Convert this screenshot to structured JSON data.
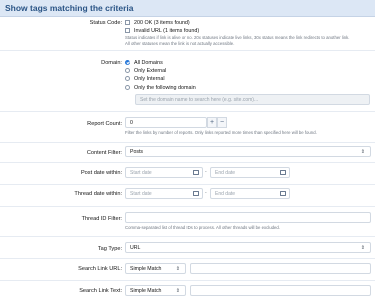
{
  "header": {
    "title": "Show tags matching the criteria"
  },
  "status_code": {
    "label": "Status Code:",
    "options": [
      "200 OK (3 items found)",
      "Invalid URL (1 items found)"
    ],
    "help": [
      "Status indicates if link is alive or no. 20x statuses indicate live links, 30x status means the link redirects to another link.",
      "All other statuses mean the link is not actually accessible."
    ]
  },
  "domain": {
    "label": "Domain:",
    "options": [
      "All Domains",
      "Only External",
      "Only Internal",
      "Only the following domain"
    ],
    "selected": "All Domains",
    "placeholder": "Set the domain name to search here (e.g. site.com)..."
  },
  "report_count": {
    "label": "Report Count:",
    "value": "0",
    "plus": "+",
    "minus": "−",
    "help": "Filter the links by number of reports. Only links reported more times than specified here will be found."
  },
  "content_filter": {
    "label": "Content Filter:",
    "value": "Posts"
  },
  "post_date": {
    "label": "Post date within:",
    "start_placeholder": "Start date",
    "end_placeholder": "End date",
    "separator": "-"
  },
  "thread_date": {
    "label": "Thread date within:",
    "start_placeholder": "Start date",
    "end_placeholder": "End date",
    "separator": "-"
  },
  "thread_id": {
    "label": "Thread ID Filter:",
    "help": "Comma-separated list of thread IDs to process. All other threads will be excluded."
  },
  "tag_type": {
    "label": "Tag Type:",
    "value": "URL"
  },
  "search_link_url": {
    "label": "Search Link URL:",
    "mode": "Simple Match"
  },
  "search_link_text": {
    "label": "Search Link Text:",
    "mode": "Simple Match"
  }
}
